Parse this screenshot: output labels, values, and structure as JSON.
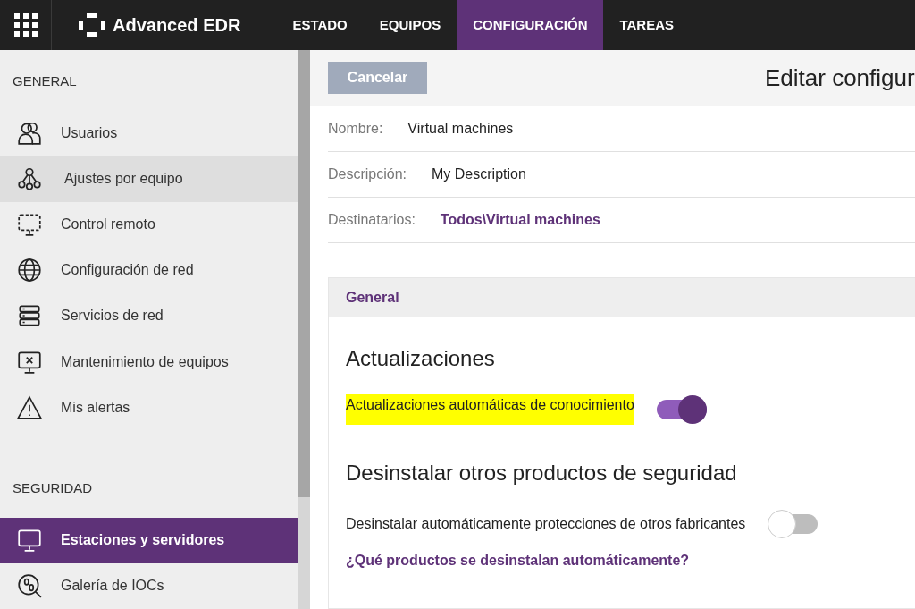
{
  "top_bar": {
    "product": "Advanced EDR",
    "tabs": [
      {
        "label": "ESTADO",
        "selected": false
      },
      {
        "label": "EQUIPOS",
        "selected": false
      },
      {
        "label": "CONFIGURACIÓN",
        "selected": true
      },
      {
        "label": "TAREAS",
        "selected": false
      }
    ]
  },
  "sidebar": {
    "sections": [
      {
        "title": "GENERAL",
        "items": [
          {
            "label": "Usuarios",
            "selected": false,
            "hovered": false
          },
          {
            "label": "Ajustes por equipo",
            "selected": false,
            "hovered": true
          },
          {
            "label": "Control remoto",
            "selected": false,
            "hovered": false
          },
          {
            "label": "Configuración de red",
            "selected": false,
            "hovered": false
          },
          {
            "label": "Servicios de red",
            "selected": false,
            "hovered": false
          },
          {
            "label": "Mantenimiento de equipos",
            "selected": false,
            "hovered": false
          },
          {
            "label": "Mis alertas",
            "selected": false,
            "hovered": false
          }
        ]
      },
      {
        "title": "SEGURIDAD",
        "items": [
          {
            "label": "Estaciones y servidores",
            "selected": true,
            "hovered": false
          },
          {
            "label": "Galería de IOCs",
            "selected": false,
            "hovered": false
          }
        ]
      }
    ]
  },
  "header": {
    "cancel_button": "Cancelar",
    "title": "Editar configur"
  },
  "fields": [
    {
      "label": "Nombre:",
      "value": "Virtual machines",
      "kind": "text"
    },
    {
      "label": "Descripción:",
      "value": "My Description",
      "kind": "text"
    },
    {
      "label": "Destinatarios:",
      "value": "Todos\\Virtual machines",
      "kind": "link"
    }
  ],
  "panel": {
    "title": "General",
    "groups": [
      {
        "heading": "Actualizaciones",
        "settings": [
          {
            "label": "Actualizaciones automáticas de conocimiento",
            "on": true,
            "highlighted": true
          }
        ]
      },
      {
        "heading": "Desinstalar otros productos de seguridad",
        "settings": [
          {
            "label": "Desinstalar automáticamente protecciones de otros fabricantes",
            "on": false,
            "highlighted": false
          }
        ],
        "link": "¿Qué productos se desinstalan automáticamente?"
      }
    ]
  }
}
